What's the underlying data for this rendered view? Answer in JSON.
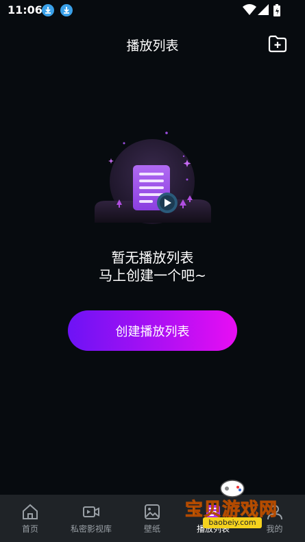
{
  "status_bar": {
    "time": "11:06"
  },
  "header": {
    "title": "播放列表"
  },
  "empty_state": {
    "line1": "暂无播放列表",
    "line2": "马上创建一个吧~"
  },
  "create_button": {
    "label": "创建播放列表"
  },
  "tabs": [
    {
      "label": "首页",
      "icon": "home-icon"
    },
    {
      "label": "私密影视库",
      "icon": "video-camera-icon"
    },
    {
      "label": "壁纸",
      "icon": "image-icon"
    },
    {
      "label": "播放列表",
      "icon": "playlist-icon",
      "active": true
    },
    {
      "label": "我的",
      "icon": "user-icon"
    }
  ],
  "watermark": {
    "text": "宝贝游戏网",
    "url": "baobeiy.com"
  },
  "colors": {
    "background": "#070b0f",
    "accent_start": "#6d13f5",
    "accent_end": "#e80ef3",
    "tabbar": "#1f2327"
  }
}
